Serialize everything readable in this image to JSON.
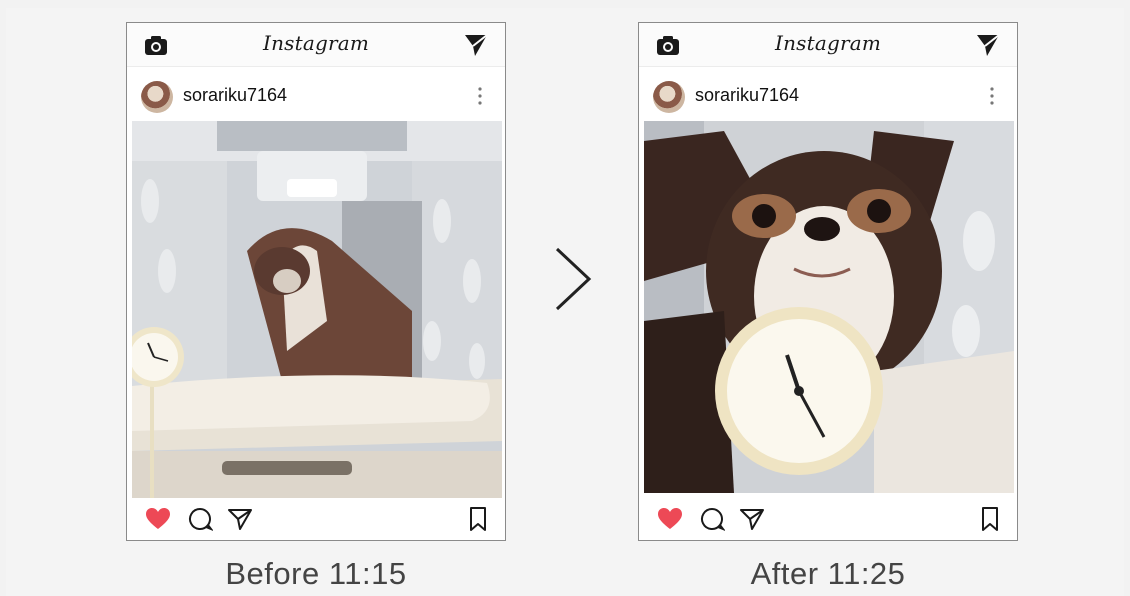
{
  "left_post": {
    "app_title": "Instagram",
    "username": "sorariku7164",
    "caption": "Before 11:15"
  },
  "right_post": {
    "app_title": "Instagram",
    "username": "sorariku7164",
    "caption": "After 11:25"
  },
  "colors": {
    "heart": "#ed4956",
    "caption_text": "#444444",
    "border": "#8a8a8a"
  },
  "icons": [
    "camera-icon",
    "send-icon",
    "more-icon",
    "heart-icon",
    "comment-icon",
    "share-icon",
    "bookmark-icon",
    "chevron-right-icon"
  ]
}
